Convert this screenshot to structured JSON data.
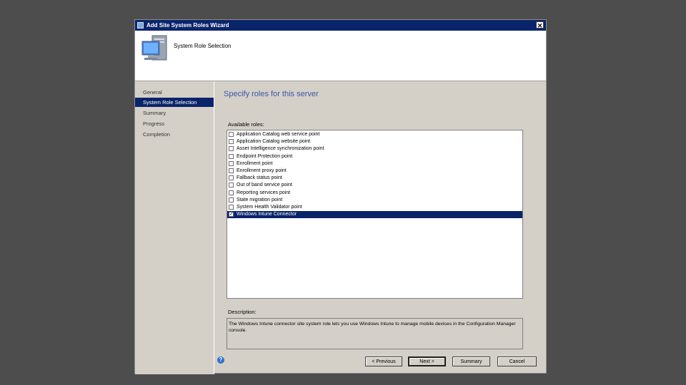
{
  "window": {
    "title": "Add Site System Roles Wizard",
    "close_glyph": "✕"
  },
  "header": {
    "heading": "System Role Selection",
    "icon": "computer-icon"
  },
  "sidebar": {
    "items": [
      {
        "label": "General",
        "active": false
      },
      {
        "label": "System Role Selection",
        "active": true
      },
      {
        "label": "Summary",
        "active": false
      },
      {
        "label": "Progress",
        "active": false
      },
      {
        "label": "Completion",
        "active": false
      }
    ]
  },
  "main": {
    "section_title": "Specify roles for this server",
    "roles_label": "Available roles:",
    "roles": [
      {
        "label": "Application Catalog web service point",
        "checked": false
      },
      {
        "label": "Application Catalog website point",
        "checked": false
      },
      {
        "label": "Asset Intelligence synchronization point",
        "checked": false
      },
      {
        "label": "Endpoint Protection point",
        "checked": false
      },
      {
        "label": "Enrollment point",
        "checked": false
      },
      {
        "label": "Enrollment proxy point",
        "checked": false
      },
      {
        "label": "Fallback status point",
        "checked": false
      },
      {
        "label": "Out of band service point",
        "checked": false
      },
      {
        "label": "Reporting services point",
        "checked": false
      },
      {
        "label": "State migration point",
        "checked": false
      },
      {
        "label": "System Health Validator point",
        "checked": false
      },
      {
        "label": "Windows Intune Connector",
        "checked": true,
        "selected": true
      }
    ],
    "description_label": "Description:",
    "description_text": "The Windows Intune connector site system role lets you use Windows Intune to manage mobile devices in the Configuration Manager console."
  },
  "buttons": {
    "previous": "< Previous",
    "next": "Next >",
    "summary": "Summary",
    "cancel": "Cancel"
  },
  "colors": {
    "accent": "#0a246a",
    "section_title": "#3b56a5",
    "background": "#4d4d4d",
    "dialog": "#d4d0c8"
  }
}
